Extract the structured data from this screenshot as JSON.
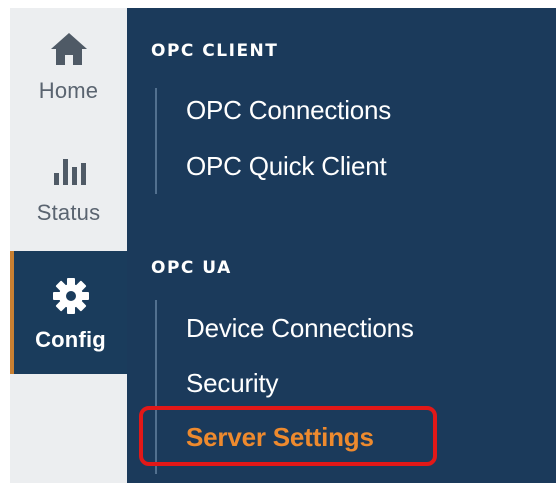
{
  "nav": {
    "home": {
      "label": "Home",
      "icon": "home-icon"
    },
    "status": {
      "label": "Status",
      "icon": "bar-chart-icon"
    },
    "config": {
      "label": "Config",
      "icon": "gear-icon",
      "active": true
    }
  },
  "menu": {
    "opc_client": {
      "heading": "OPC CLIENT",
      "items": [
        "OPC Connections",
        "OPC Quick Client"
      ]
    },
    "opc_ua": {
      "heading": "OPC UA",
      "items": [
        "Device Connections",
        "Security",
        "Server Settings"
      ]
    }
  },
  "colors": {
    "panel_bg": "#1b3a5b",
    "nav_bg": "#eceef0",
    "accent_orange": "#ee8a2e",
    "highlight_red": "#e21818"
  }
}
